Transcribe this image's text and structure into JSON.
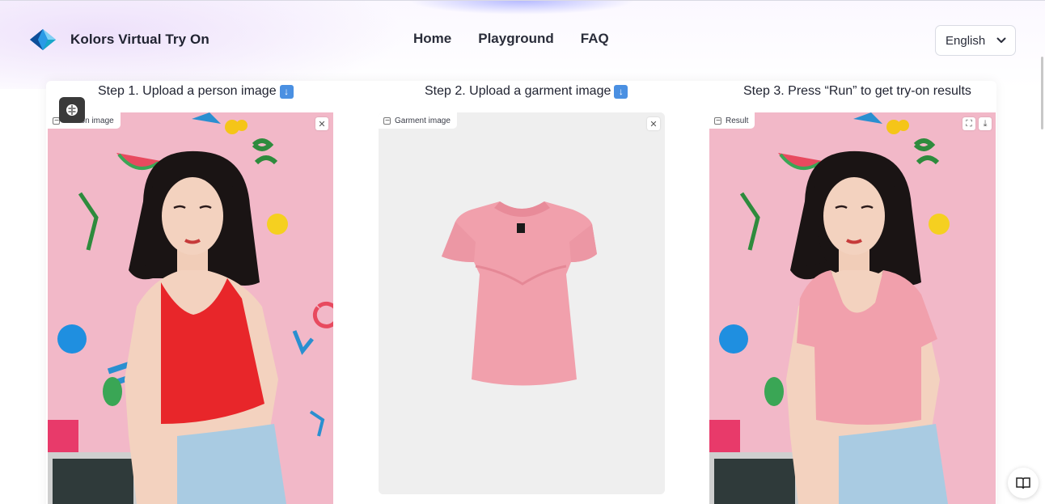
{
  "header": {
    "brand_name": "Kolors Virtual Try On",
    "nav": [
      {
        "label": "Home"
      },
      {
        "label": "Playground"
      },
      {
        "label": "FAQ"
      }
    ],
    "language": "English"
  },
  "steps": {
    "step1_title": "Step 1. Upload a person image",
    "step2_title": "Step 2. Upload a garment image",
    "step3_title": "Step 3. Press “Run” to get try-on results"
  },
  "panels": {
    "person_label": "Person image",
    "garment_label": "Garment image",
    "result_label": "Result"
  },
  "colors": {
    "accent": "#4a90e2",
    "person_bg": "#f2b8c8",
    "red_top": "#e8262a",
    "pink_top": "#f1a0ac",
    "jeans": "#a9cbe2",
    "hair": "#1a1414",
    "skin": "#f3d2bf"
  },
  "icons": [
    "logo-icon",
    "chevron-down-icon",
    "image-icon",
    "close-icon",
    "fullscreen-icon",
    "download-icon",
    "brain-icon",
    "book-icon"
  ]
}
